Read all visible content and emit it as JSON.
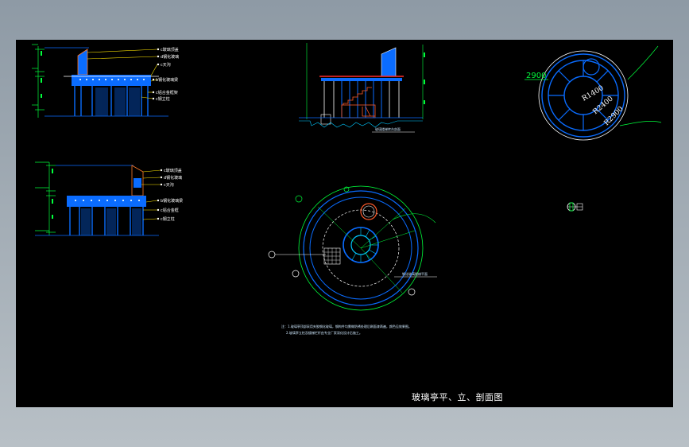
{
  "drawing": {
    "title": "玻璃亭平、立、剖面图",
    "colors": {
      "background": "#000000",
      "frame": "#8e9aa5",
      "roof_blue": "#0a6cff",
      "line_cyan": "#00c8ff",
      "line_yellow": "#ffe600",
      "line_green": "#00ff3c",
      "line_white": "#ffffff",
      "stair_red": "#ff5a2a"
    }
  },
  "elevation_front": {
    "labels": [
      "c玻璃顶盖",
      "d钢化玻璃",
      "c天沟",
      "b钢化玻璃梁",
      "c铝合金框架",
      "c钢立柱"
    ]
  },
  "elevation_side": {
    "labels": [
      "c玻璃顶盖",
      "d钢化玻璃",
      "c天沟",
      "b钢化玻璃梁",
      "c铝合金框",
      "c钢立柱"
    ]
  },
  "section": {
    "note": "玻璃楼梯转台剖面"
  },
  "roof_plan": {
    "dim_outer": "2900",
    "radius_1": "R1400",
    "radius_2": "R2400",
    "radius_3": "R2900"
  },
  "floor_plan": {
    "note_label": "钢化玻璃楼梯平面"
  },
  "notes": {
    "line1": "注：1.玻璃亭顶部采用夹胶钢化玻璃，钢构件均需做防锈处理后刷面漆两遍，颜色见效果图。",
    "line2": "2.玻璃亭立柱及楼梯栏杆由专业厂家深化设计后施工。"
  }
}
